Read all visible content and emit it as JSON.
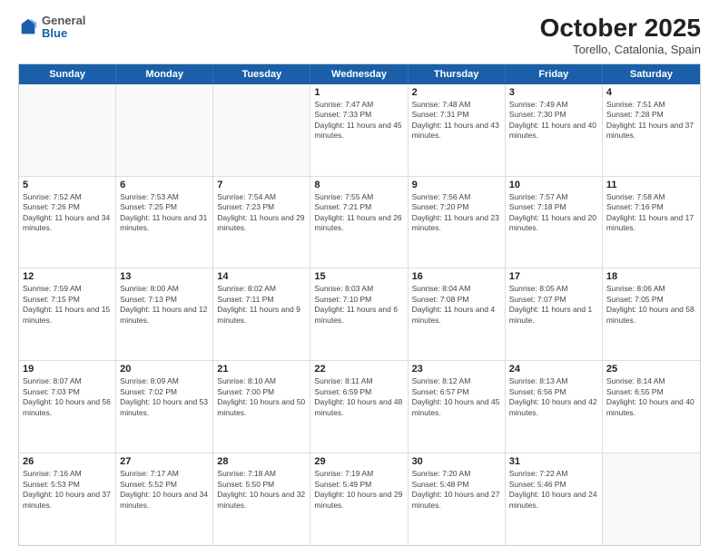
{
  "header": {
    "logo": {
      "general": "General",
      "blue": "Blue"
    },
    "month_title": "October 2025",
    "location": "Torello, Catalonia, Spain"
  },
  "weekdays": [
    "Sunday",
    "Monday",
    "Tuesday",
    "Wednesday",
    "Thursday",
    "Friday",
    "Saturday"
  ],
  "weeks": [
    [
      {
        "day": "",
        "sunrise": "",
        "sunset": "",
        "daylight": ""
      },
      {
        "day": "",
        "sunrise": "",
        "sunset": "",
        "daylight": ""
      },
      {
        "day": "",
        "sunrise": "",
        "sunset": "",
        "daylight": ""
      },
      {
        "day": "1",
        "sunrise": "Sunrise: 7:47 AM",
        "sunset": "Sunset: 7:33 PM",
        "daylight": "Daylight: 11 hours and 45 minutes."
      },
      {
        "day": "2",
        "sunrise": "Sunrise: 7:48 AM",
        "sunset": "Sunset: 7:31 PM",
        "daylight": "Daylight: 11 hours and 43 minutes."
      },
      {
        "day": "3",
        "sunrise": "Sunrise: 7:49 AM",
        "sunset": "Sunset: 7:30 PM",
        "daylight": "Daylight: 11 hours and 40 minutes."
      },
      {
        "day": "4",
        "sunrise": "Sunrise: 7:51 AM",
        "sunset": "Sunset: 7:28 PM",
        "daylight": "Daylight: 11 hours and 37 minutes."
      }
    ],
    [
      {
        "day": "5",
        "sunrise": "Sunrise: 7:52 AM",
        "sunset": "Sunset: 7:26 PM",
        "daylight": "Daylight: 11 hours and 34 minutes."
      },
      {
        "day": "6",
        "sunrise": "Sunrise: 7:53 AM",
        "sunset": "Sunset: 7:25 PM",
        "daylight": "Daylight: 11 hours and 31 minutes."
      },
      {
        "day": "7",
        "sunrise": "Sunrise: 7:54 AM",
        "sunset": "Sunset: 7:23 PM",
        "daylight": "Daylight: 11 hours and 29 minutes."
      },
      {
        "day": "8",
        "sunrise": "Sunrise: 7:55 AM",
        "sunset": "Sunset: 7:21 PM",
        "daylight": "Daylight: 11 hours and 26 minutes."
      },
      {
        "day": "9",
        "sunrise": "Sunrise: 7:56 AM",
        "sunset": "Sunset: 7:20 PM",
        "daylight": "Daylight: 11 hours and 23 minutes."
      },
      {
        "day": "10",
        "sunrise": "Sunrise: 7:57 AM",
        "sunset": "Sunset: 7:18 PM",
        "daylight": "Daylight: 11 hours and 20 minutes."
      },
      {
        "day": "11",
        "sunrise": "Sunrise: 7:58 AM",
        "sunset": "Sunset: 7:16 PM",
        "daylight": "Daylight: 11 hours and 17 minutes."
      }
    ],
    [
      {
        "day": "12",
        "sunrise": "Sunrise: 7:59 AM",
        "sunset": "Sunset: 7:15 PM",
        "daylight": "Daylight: 11 hours and 15 minutes."
      },
      {
        "day": "13",
        "sunrise": "Sunrise: 8:00 AM",
        "sunset": "Sunset: 7:13 PM",
        "daylight": "Daylight: 11 hours and 12 minutes."
      },
      {
        "day": "14",
        "sunrise": "Sunrise: 8:02 AM",
        "sunset": "Sunset: 7:11 PM",
        "daylight": "Daylight: 11 hours and 9 minutes."
      },
      {
        "day": "15",
        "sunrise": "Sunrise: 8:03 AM",
        "sunset": "Sunset: 7:10 PM",
        "daylight": "Daylight: 11 hours and 6 minutes."
      },
      {
        "day": "16",
        "sunrise": "Sunrise: 8:04 AM",
        "sunset": "Sunset: 7:08 PM",
        "daylight": "Daylight: 11 hours and 4 minutes."
      },
      {
        "day": "17",
        "sunrise": "Sunrise: 8:05 AM",
        "sunset": "Sunset: 7:07 PM",
        "daylight": "Daylight: 11 hours and 1 minute."
      },
      {
        "day": "18",
        "sunrise": "Sunrise: 8:06 AM",
        "sunset": "Sunset: 7:05 PM",
        "daylight": "Daylight: 10 hours and 58 minutes."
      }
    ],
    [
      {
        "day": "19",
        "sunrise": "Sunrise: 8:07 AM",
        "sunset": "Sunset: 7:03 PM",
        "daylight": "Daylight: 10 hours and 56 minutes."
      },
      {
        "day": "20",
        "sunrise": "Sunrise: 8:09 AM",
        "sunset": "Sunset: 7:02 PM",
        "daylight": "Daylight: 10 hours and 53 minutes."
      },
      {
        "day": "21",
        "sunrise": "Sunrise: 8:10 AM",
        "sunset": "Sunset: 7:00 PM",
        "daylight": "Daylight: 10 hours and 50 minutes."
      },
      {
        "day": "22",
        "sunrise": "Sunrise: 8:11 AM",
        "sunset": "Sunset: 6:59 PM",
        "daylight": "Daylight: 10 hours and 48 minutes."
      },
      {
        "day": "23",
        "sunrise": "Sunrise: 8:12 AM",
        "sunset": "Sunset: 6:57 PM",
        "daylight": "Daylight: 10 hours and 45 minutes."
      },
      {
        "day": "24",
        "sunrise": "Sunrise: 8:13 AM",
        "sunset": "Sunset: 6:56 PM",
        "daylight": "Daylight: 10 hours and 42 minutes."
      },
      {
        "day": "25",
        "sunrise": "Sunrise: 8:14 AM",
        "sunset": "Sunset: 6:55 PM",
        "daylight": "Daylight: 10 hours and 40 minutes."
      }
    ],
    [
      {
        "day": "26",
        "sunrise": "Sunrise: 7:16 AM",
        "sunset": "Sunset: 5:53 PM",
        "daylight": "Daylight: 10 hours and 37 minutes."
      },
      {
        "day": "27",
        "sunrise": "Sunrise: 7:17 AM",
        "sunset": "Sunset: 5:52 PM",
        "daylight": "Daylight: 10 hours and 34 minutes."
      },
      {
        "day": "28",
        "sunrise": "Sunrise: 7:18 AM",
        "sunset": "Sunset: 5:50 PM",
        "daylight": "Daylight: 10 hours and 32 minutes."
      },
      {
        "day": "29",
        "sunrise": "Sunrise: 7:19 AM",
        "sunset": "Sunset: 5:49 PM",
        "daylight": "Daylight: 10 hours and 29 minutes."
      },
      {
        "day": "30",
        "sunrise": "Sunrise: 7:20 AM",
        "sunset": "Sunset: 5:48 PM",
        "daylight": "Daylight: 10 hours and 27 minutes."
      },
      {
        "day": "31",
        "sunrise": "Sunrise: 7:22 AM",
        "sunset": "Sunset: 5:46 PM",
        "daylight": "Daylight: 10 hours and 24 minutes."
      },
      {
        "day": "",
        "sunrise": "",
        "sunset": "",
        "daylight": ""
      }
    ]
  ]
}
